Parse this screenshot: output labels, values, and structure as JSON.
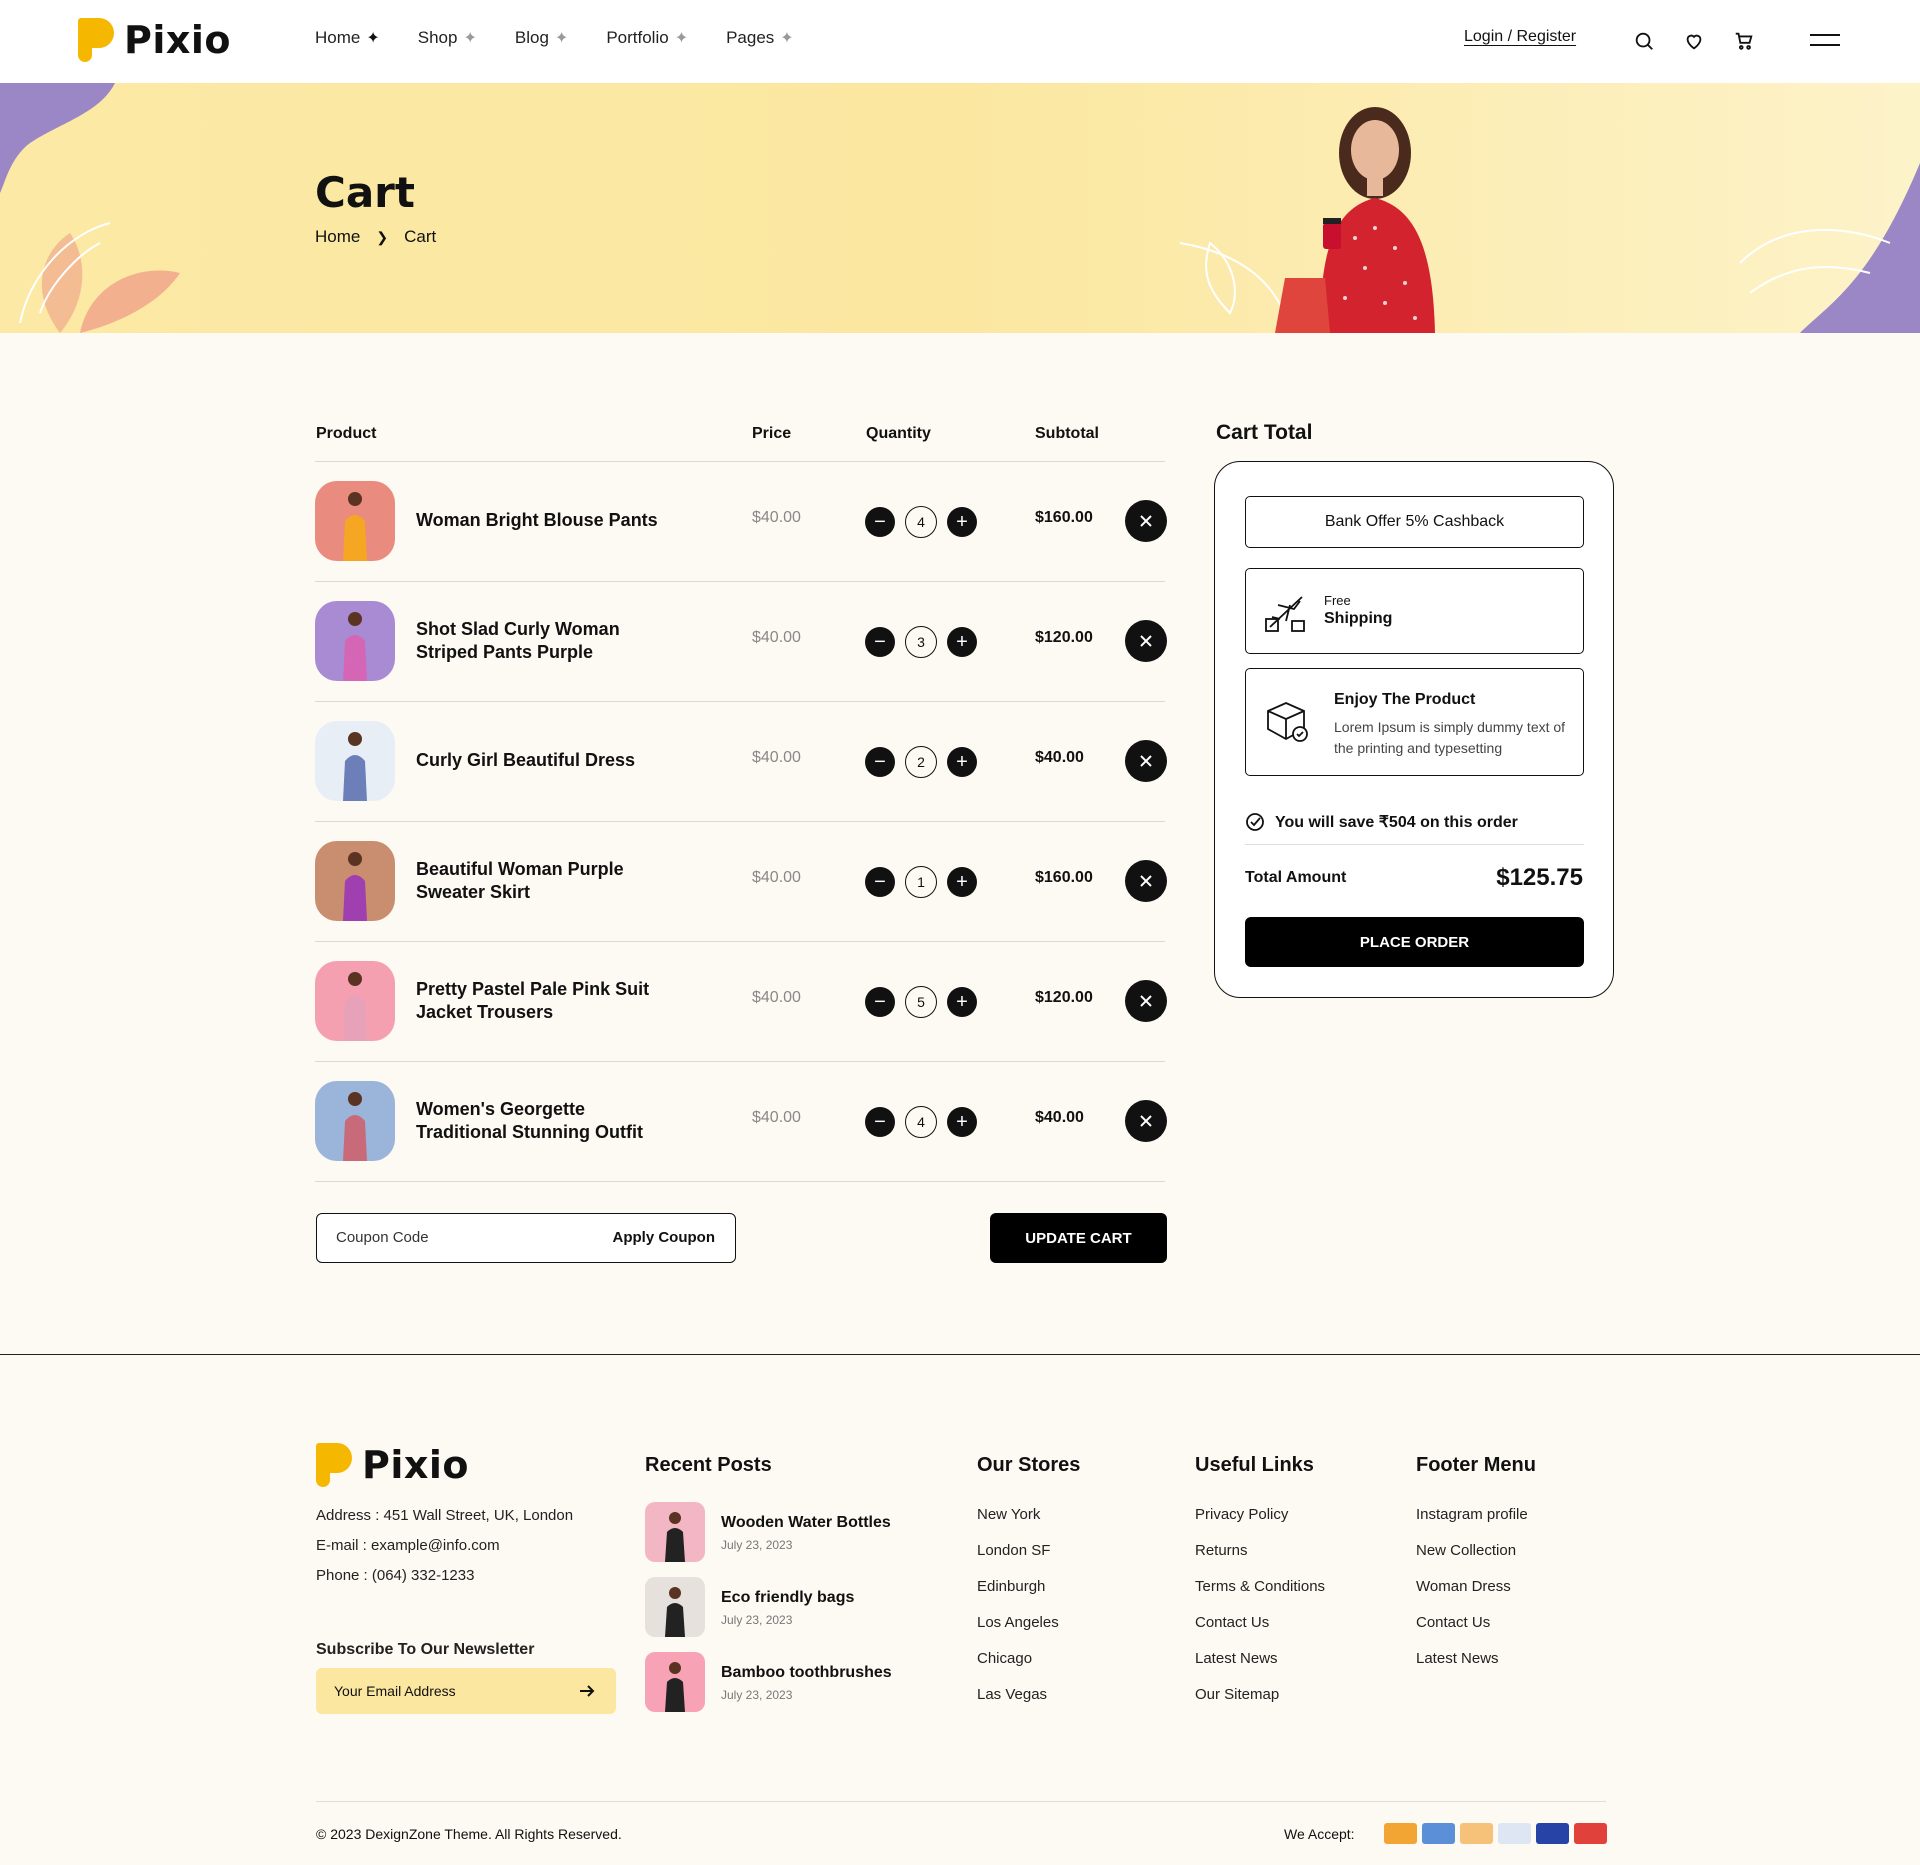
{
  "brand": {
    "name": "Pixio"
  },
  "nav": {
    "items": [
      {
        "label": "Home",
        "active": true
      },
      {
        "label": "Shop"
      },
      {
        "label": "Blog"
      },
      {
        "label": "Portfolio"
      },
      {
        "label": "Pages"
      }
    ],
    "login": "Login / Register",
    "icons": [
      "search-icon",
      "heart-icon",
      "cart-icon",
      "menu-icon"
    ]
  },
  "banner": {
    "title": "Cart",
    "breadcrumb": [
      "Home",
      "Cart"
    ]
  },
  "cart": {
    "headers": {
      "product": "Product",
      "price": "Price",
      "quantity": "Quantity",
      "subtotal": "Subtotal"
    },
    "items": [
      {
        "name": "Woman Bright Blouse Pants",
        "price": "$40.00",
        "qty": "4",
        "subtotal": "$160.00",
        "thumb_bg": "#e98b7e",
        "figure": "#f5a623"
      },
      {
        "name": "Shot Slad Curly Woman Striped Pants Purple",
        "price": "$40.00",
        "qty": "3",
        "subtotal": "$120.00",
        "thumb_bg": "#a98bd4",
        "figure": "#d566b5"
      },
      {
        "name": "Curly Girl Beautiful Dress",
        "price": "$40.00",
        "qty": "2",
        "subtotal": "$40.00",
        "thumb_bg": "#e8eef5",
        "figure": "#6c7fb8"
      },
      {
        "name": "Beautiful Woman Purple Sweater Skirt",
        "price": "$40.00",
        "qty": "1",
        "subtotal": "$160.00",
        "thumb_bg": "#c98d6f",
        "figure": "#a03fb0"
      },
      {
        "name": "Pretty Pastel Pale Pink Suit Jacket Trousers",
        "price": "$40.00",
        "qty": "5",
        "subtotal": "$120.00",
        "thumb_bg": "#f5a0b0",
        "figure": "#e7a2ba"
      },
      {
        "name": "Women's Georgette Traditional Stunning Outfit",
        "price": "$40.00",
        "qty": "4",
        "subtotal": "$40.00",
        "thumb_bg": "#9ab5d9",
        "figure": "#c86a7a"
      }
    ],
    "coupon_placeholder": "Coupon Code",
    "apply_coupon": "Apply Coupon",
    "update_cart": "UPDATE CART"
  },
  "cart_total": {
    "title": "Cart Total",
    "offer": "Bank Offer 5% Cashback",
    "shipping_small": "Free",
    "shipping_label": "Shipping",
    "enjoy_title": "Enjoy The Product",
    "enjoy_text": "Lorem Ipsum is simply dummy text of the printing and typesetting",
    "save_text": "You will save ₹504 on this order",
    "total_label": "Total Amount",
    "total_value": "$125.75",
    "place_order": "PLACE ORDER"
  },
  "footer": {
    "address": "Address : 451 Wall Street, UK, London",
    "email": "E-mail : example@info.com",
    "phone": "Phone : (064) 332-1233",
    "newsletter_title": "Subscribe To Our Newsletter",
    "newsletter_placeholder": "Your Email Address",
    "recent_posts_title": "Recent Posts",
    "posts": [
      {
        "title": "Wooden Water Bottles",
        "date": "July 23, 2023",
        "bg": "#f3b6c4"
      },
      {
        "title": "Eco friendly bags",
        "date": "July 23, 2023",
        "bg": "#e6e1dc"
      },
      {
        "title": "Bamboo toothbrushes",
        "date": "July 23, 2023",
        "bg": "#f7a3b5"
      }
    ],
    "stores_title": "Our Stores",
    "stores": [
      "New York",
      "London SF",
      "Edinburgh",
      "Los Angeles",
      "Chicago",
      "Las Vegas"
    ],
    "useful_title": "Useful Links",
    "useful": [
      "Privacy Policy",
      "Returns",
      "Terms & Conditions",
      "Contact Us",
      "Latest News",
      "Our Sitemap"
    ],
    "menu_title": "Footer Menu",
    "menu": [
      "Instagram profile",
      "New Collection",
      "Woman Dress",
      "Contact Us",
      "Latest News"
    ],
    "copyright": "© 2023 DexignZone Theme. All Rights Reserved.",
    "we_accept": "We Accept:",
    "cards": [
      "#f3a533",
      "#5b8fd8",
      "#f6c27a",
      "#dfe6f3",
      "#2743a6",
      "#e0413a"
    ]
  }
}
